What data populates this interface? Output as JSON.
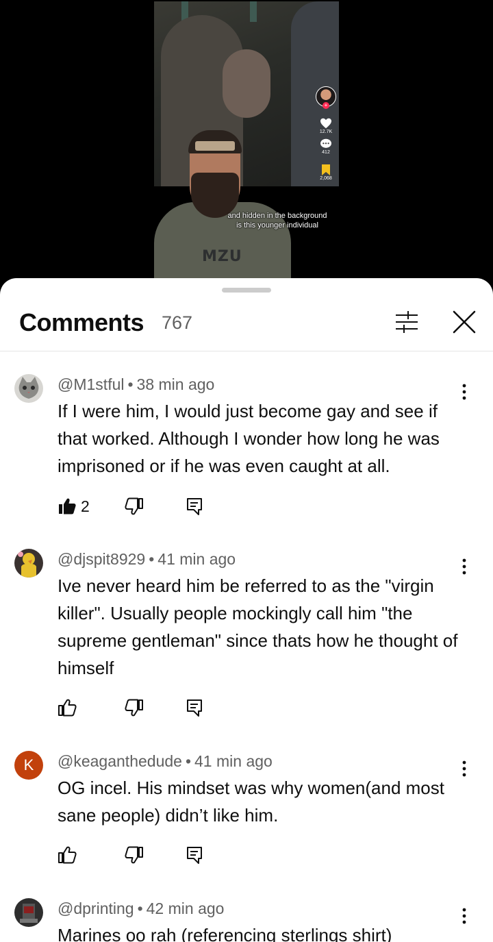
{
  "video": {
    "caption": "and hidden in the background is this younger individual",
    "shirt_text": "MZU",
    "side": {
      "likes": "12.7K",
      "comments": "412",
      "saves": "2,068"
    }
  },
  "comments_panel": {
    "title": "Comments",
    "count": "767",
    "filter_icon": "sliders-icon",
    "close_icon": "close-icon"
  },
  "comments": [
    {
      "author": "@M1stful",
      "time": "38 min ago",
      "text": "If I were him, I would just become gay and see if that worked. Although I wonder how long he was imprisoned or if he was even caught at all.",
      "likes": "2",
      "liked": true,
      "avatar_color": "#8a8a86"
    },
    {
      "author": "@djspit8929",
      "time": "41 min ago",
      "text": "Ive never heard him be referred to as the \"virgin killer\". Usually people mockingly call him \"the supreme gentleman\" since thats how he thought of himself",
      "likes": "",
      "liked": false,
      "avatar_color": "#d9b33a"
    },
    {
      "author": "@keaganthedude",
      "time": "41 min ago",
      "text": "OG incel. His mindset was why women(and most sane people) didn’t like him.",
      "likes": "",
      "liked": false,
      "avatar_letter": "K",
      "avatar_color": "#c2410c"
    },
    {
      "author": "@dprinting",
      "time": "42 min ago",
      "text": "Marines oo rah (referencing sterlings shirt)",
      "likes": "",
      "liked": false,
      "avatar_color": "#3b3b3b"
    }
  ]
}
